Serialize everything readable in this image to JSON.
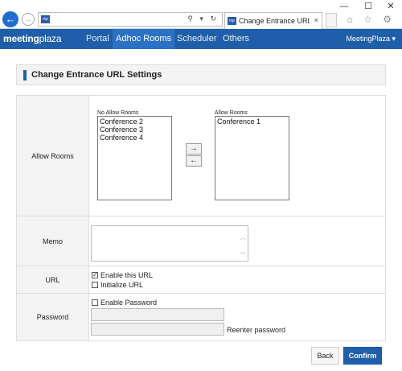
{
  "browser": {
    "favicon_text": "mp",
    "tab_title": "Change Entrance URL Setti...",
    "tab_close": "×",
    "window_controls": [
      "—",
      "☐",
      "✕"
    ],
    "addr_icons": "⚲ ▾ ↻",
    "toolbar_icons": "⌂ ☆ ⚙"
  },
  "nav": {
    "logo_bold": "meeting",
    "logo_rest": "plaza",
    "items": [
      "Portal",
      "Adhoc Rooms",
      "Scheduler",
      "Others"
    ],
    "user": "MeetingPlaza ▾"
  },
  "page": {
    "title": "Change Entrance URL Settings"
  },
  "form": {
    "allow_rooms": {
      "label": "Allow Rooms",
      "no_allow_caption": "No Allow Rooms",
      "allow_caption": "Allow Rooms",
      "no_allow_items": [
        "Conference 2",
        "Conference 3",
        "Conference 4"
      ],
      "allow_items": [
        "Conference 1"
      ],
      "move_right": "→",
      "move_left": "←"
    },
    "memo": {
      "label": "Memo",
      "value": ""
    },
    "url": {
      "label": "URL",
      "enable_label": "Enable this URL",
      "enable_checked": true,
      "initialize_label": "Initialize URL",
      "initialize_checked": false
    },
    "password": {
      "label": "Password",
      "enable_label": "Enable Password",
      "enable_checked": false,
      "reenter_label": "Reenter password"
    }
  },
  "buttons": {
    "back": "Back",
    "confirm": "Confirm"
  }
}
